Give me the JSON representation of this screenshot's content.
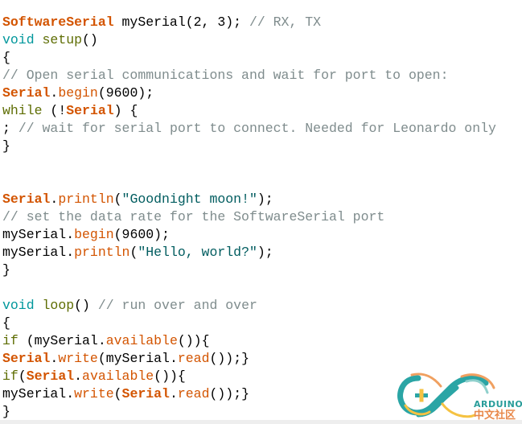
{
  "code_lines": [
    [
      [
        "SoftwareSerial",
        "k"
      ],
      [
        " mySerial(2, 3); ",
        ""
      ],
      [
        "// RX, TX",
        "c"
      ]
    ],
    [
      [
        "void",
        "t"
      ],
      [
        " ",
        ""
      ],
      [
        "setup",
        "o"
      ],
      [
        "()",
        ""
      ]
    ],
    [
      [
        "{",
        ""
      ]
    ],
    [
      [
        "// Open serial communications and wait for port to open:",
        "c"
      ]
    ],
    [
      [
        "Serial",
        "k"
      ],
      [
        ".",
        ""
      ],
      [
        "begin",
        "f"
      ],
      [
        "(9600);",
        ""
      ]
    ],
    [
      [
        "while",
        "o"
      ],
      [
        " (!",
        ""
      ],
      [
        "Serial",
        "k"
      ],
      [
        ") {",
        ""
      ]
    ],
    [
      [
        "; ",
        ""
      ],
      [
        "// wait for serial port to connect. Needed for Leonardo only",
        "c"
      ]
    ],
    [
      [
        "}",
        ""
      ]
    ],
    [],
    [],
    [
      [
        "Serial",
        "k"
      ],
      [
        ".",
        ""
      ],
      [
        "println",
        "f"
      ],
      [
        "(",
        ""
      ],
      [
        "\"Goodnight moon!\"",
        "s"
      ],
      [
        ");",
        ""
      ]
    ],
    [
      [
        "// set the data rate for the SoftwareSerial port",
        "c"
      ]
    ],
    [
      [
        "mySerial.",
        ""
      ],
      [
        "begin",
        "f"
      ],
      [
        "(9600);",
        ""
      ]
    ],
    [
      [
        "mySerial.",
        ""
      ],
      [
        "println",
        "f"
      ],
      [
        "(",
        ""
      ],
      [
        "\"Hello, world?\"",
        "s"
      ],
      [
        ");",
        ""
      ]
    ],
    [
      [
        "}",
        ""
      ]
    ],
    [],
    [
      [
        "void",
        "t"
      ],
      [
        " ",
        ""
      ],
      [
        "loop",
        "o"
      ],
      [
        "() ",
        ""
      ],
      [
        "// run over and over",
        "c"
      ]
    ],
    [
      [
        "{",
        ""
      ]
    ],
    [
      [
        "if",
        "o"
      ],
      [
        " (mySerial.",
        ""
      ],
      [
        "available",
        "f"
      ],
      [
        "()){",
        ""
      ]
    ],
    [
      [
        "Serial",
        "k"
      ],
      [
        ".",
        ""
      ],
      [
        "write",
        "f"
      ],
      [
        "(mySerial.",
        ""
      ],
      [
        "read",
        "f"
      ],
      [
        "());}",
        ""
      ]
    ],
    [
      [
        "if",
        "o"
      ],
      [
        "(",
        ""
      ],
      [
        "Serial",
        "k"
      ],
      [
        ".",
        ""
      ],
      [
        "available",
        "f"
      ],
      [
        "()){",
        ""
      ]
    ],
    [
      [
        "mySerial.",
        ""
      ],
      [
        "write",
        "f"
      ],
      [
        "(",
        ""
      ],
      [
        "Serial",
        "k"
      ],
      [
        ".",
        ""
      ],
      [
        "read",
        "f"
      ],
      [
        "());}",
        ""
      ]
    ],
    [
      [
        "}",
        ""
      ]
    ]
  ],
  "colors": {
    "type_keyword": "#D35400",
    "function": "#D35400",
    "void": "#00979C",
    "control": "#5E6D03",
    "string": "#005C5F",
    "comment": "#7F8C8D"
  },
  "logo": {
    "icon": "arduino-infinity-logo",
    "text_en": "ARDUINO",
    "text_zh": "中文社区"
  }
}
